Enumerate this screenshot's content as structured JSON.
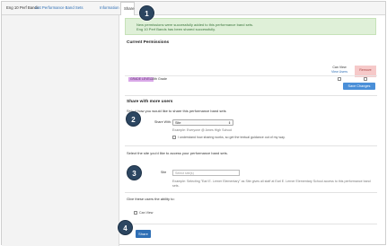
{
  "tabs": {
    "title": "Eng 10 Perf Bands",
    "list": "List Performance Band Sets",
    "information": "Information",
    "share": "Share"
  },
  "alert": {
    "line1": "New permissions were successfully added to this performance band sets.",
    "line2": "Eng 10 Perf Bands has been shared successfully."
  },
  "current_permissions": {
    "title": "Current Permissions",
    "col_can_view": "Can View",
    "col_view_users": "View Users",
    "col_remove": "Remove",
    "row": {
      "badge": "GRADE LEVEL",
      "name": "10th Grade"
    },
    "save_button": "Save Changes"
  },
  "share": {
    "title": "Share with more users",
    "subtitle": "Select how you would like to share this performance band sets",
    "share_with_label": "Share With:",
    "share_with_value": "Site",
    "example_share": "Example: Everyone @ Ames High School",
    "understand_text": "I understand how sharing works, so get the textual guidance out of my way.",
    "select_site_prompt": "Select the site you'd like to access your performance band sets.",
    "site_label": "Site",
    "site_placeholder": "Select site(s)",
    "example_site": "Example: Selecting \"Earl E. Lerner Elementary\" as Site gives all staff at Earl E. Lerner Elementary School access to this performance band sets.",
    "ability_text": "Give these users the ability to:",
    "can_view_label": "Can View",
    "share_button": "Share"
  },
  "markers": [
    "1",
    "2",
    "3",
    "4"
  ]
}
